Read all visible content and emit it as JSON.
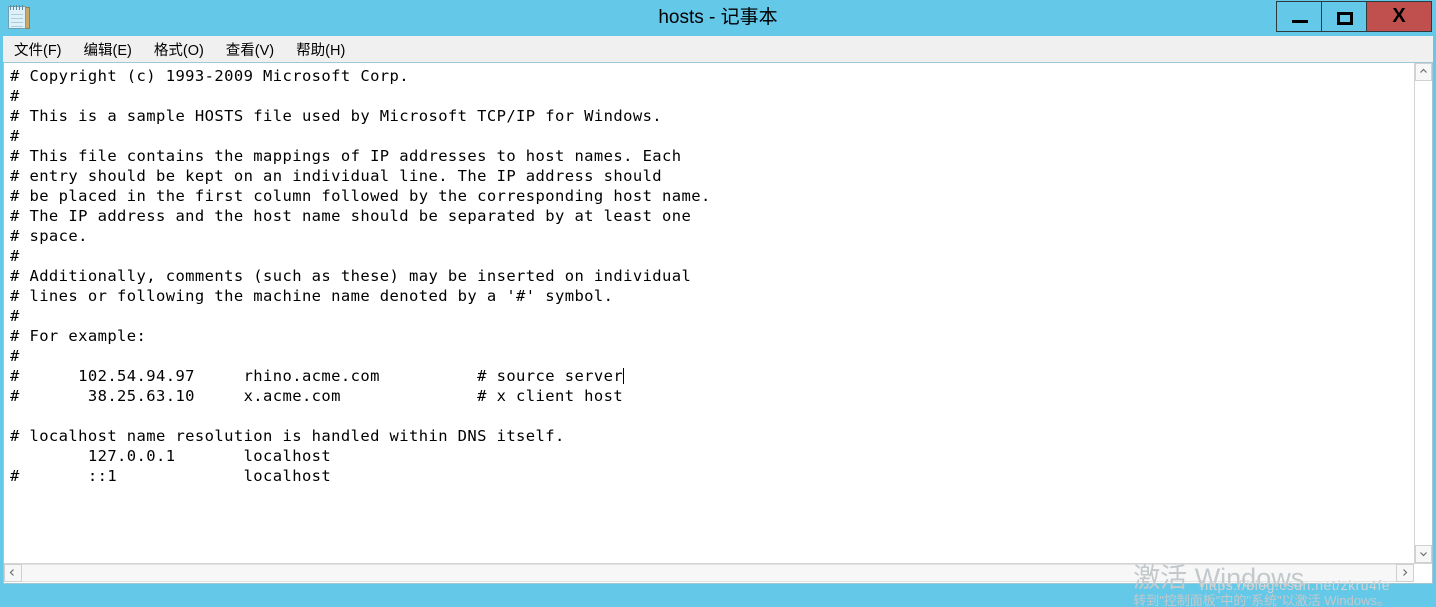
{
  "window": {
    "title": "hosts - 记事本",
    "icon": "notepad-icon",
    "titlebar_color": "#64c8e8",
    "close_button_color": "#c0504d",
    "controls": {
      "minimize": "—",
      "maximize": "□",
      "close": "X"
    }
  },
  "menubar": {
    "items": [
      {
        "label": "文件(F)"
      },
      {
        "label": "编辑(E)"
      },
      {
        "label": "格式(O)"
      },
      {
        "label": "查看(V)"
      },
      {
        "label": "帮助(H)"
      }
    ]
  },
  "editor": {
    "lines": [
      "# Copyright (c) 1993-2009 Microsoft Corp.",
      "#",
      "# This is a sample HOSTS file used by Microsoft TCP/IP for Windows.",
      "#",
      "# This file contains the mappings of IP addresses to host names. Each",
      "# entry should be kept on an individual line. The IP address should",
      "# be placed in the first column followed by the corresponding host name.",
      "# The IP address and the host name should be separated by at least one",
      "# space.",
      "#",
      "# Additionally, comments (such as these) may be inserted on individual",
      "# lines or following the machine name denoted by a '#' symbol.",
      "#",
      "# For example:",
      "#",
      "#      102.54.94.97     rhino.acme.com          # source server",
      "#       38.25.63.10     x.acme.com              # x client host",
      "",
      "# localhost name resolution is handled within DNS itself.",
      "        127.0.0.1       localhost",
      "#       ::1             localhost"
    ],
    "caret_line_index": 15,
    "caret_after_text": "# source server"
  },
  "scrollbars": {
    "vertical": {
      "up_icon": "chevron-up-icon",
      "down_icon": "chevron-down-icon"
    },
    "horizontal": {
      "left_icon": "chevron-left-icon",
      "right_icon": "chevron-right-icon"
    }
  },
  "watermark": {
    "title": "激活 Windows",
    "subtitle": "转到\"控制面板\"中的\"系统\"以激活 Windows。",
    "overlay_url": "https://blog.csdn.net/zkru4fe"
  }
}
